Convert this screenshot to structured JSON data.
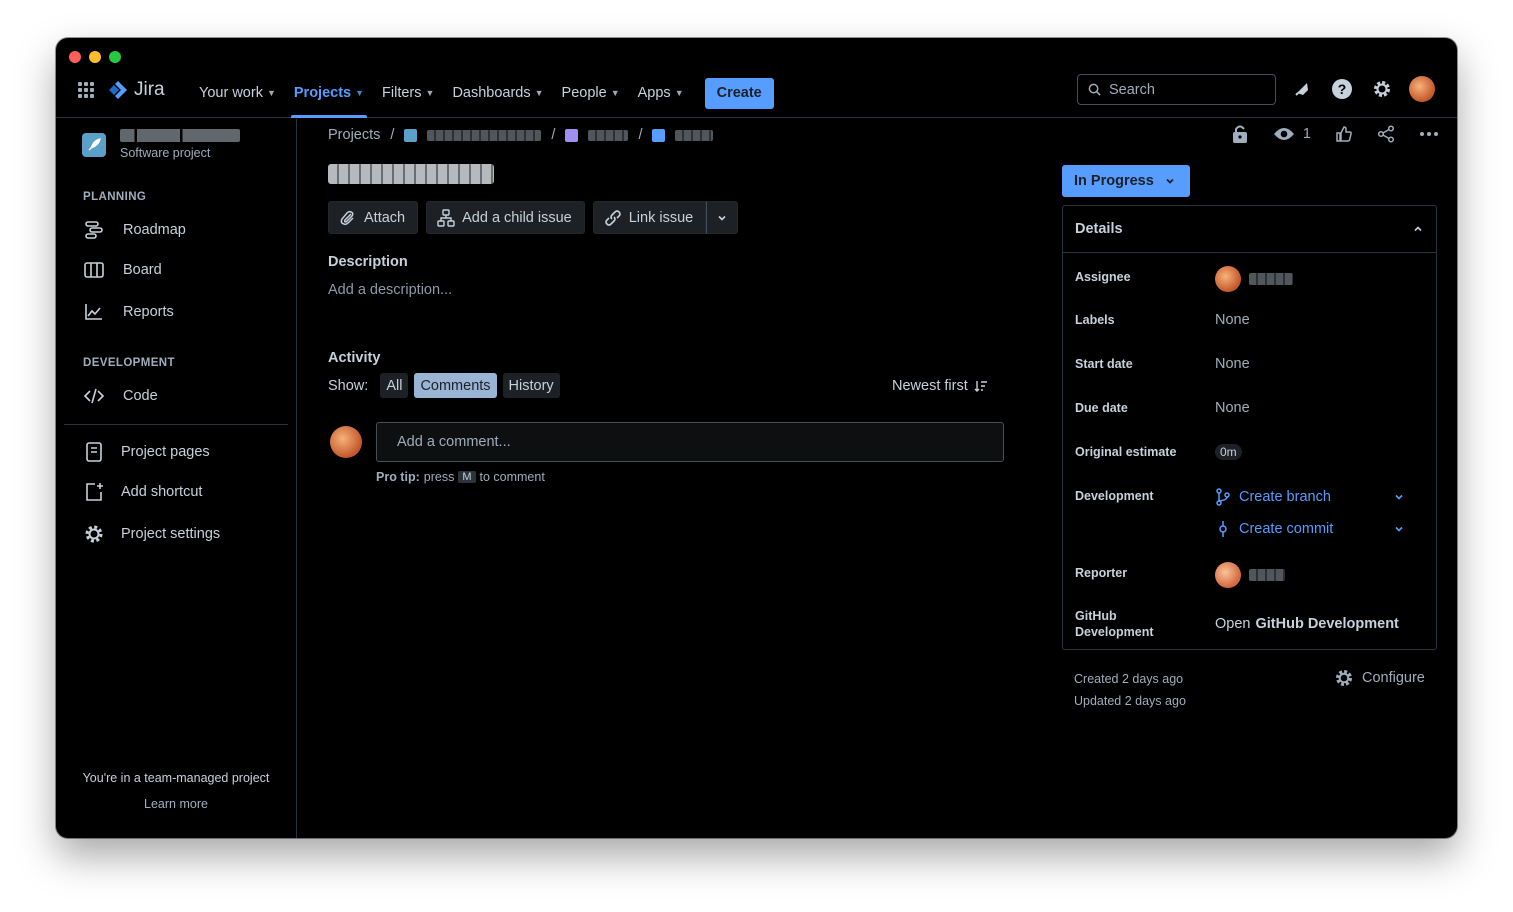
{
  "nav": {
    "logo": "Jira",
    "items": [
      {
        "label": "Your work"
      },
      {
        "label": "Projects"
      },
      {
        "label": "Filters"
      },
      {
        "label": "Dashboards"
      },
      {
        "label": "People"
      },
      {
        "label": "Apps"
      }
    ],
    "create": "Create",
    "search_placeholder": "Search"
  },
  "sidebar": {
    "project_type": "Software project",
    "planning_header": "PLANNING",
    "planning": [
      {
        "label": "Roadmap",
        "icon": "roadmap-icon"
      },
      {
        "label": "Board",
        "icon": "board-icon"
      },
      {
        "label": "Reports",
        "icon": "reports-icon"
      }
    ],
    "development_header": "DEVELOPMENT",
    "development": [
      {
        "label": "Code",
        "icon": "code-icon"
      }
    ],
    "extras": [
      {
        "label": "Project pages",
        "icon": "page-icon"
      },
      {
        "label": "Add shortcut",
        "icon": "add-shortcut-icon"
      },
      {
        "label": "Project settings",
        "icon": "gear-icon"
      }
    ],
    "team_note": "You're in a team-managed project",
    "learn_more": "Learn more"
  },
  "breadcrumb": {
    "root": "Projects",
    "sep": "/"
  },
  "toolbar": {
    "watchers": "1"
  },
  "issue": {
    "actions": {
      "attach": "Attach",
      "child": "Add a child issue",
      "link": "Link issue"
    },
    "description_header": "Description",
    "description_placeholder": "Add a description...",
    "activity_header": "Activity",
    "show_label": "Show:",
    "filters": [
      "All",
      "Comments",
      "History"
    ],
    "sort": "Newest first",
    "comment_placeholder": "Add a comment...",
    "protip_bold": "Pro tip:",
    "protip_press": "press",
    "protip_key": "M",
    "protip_rest": "to comment"
  },
  "status": {
    "label": "In Progress"
  },
  "details": {
    "header": "Details",
    "assignee_label": "Assignee",
    "labels_label": "Labels",
    "labels_value": "None",
    "start_label": "Start date",
    "start_value": "None",
    "due_label": "Due date",
    "due_value": "None",
    "estimate_label": "Original estimate",
    "estimate_value": "0m",
    "development_label": "Development",
    "create_branch": "Create branch",
    "create_commit": "Create commit",
    "reporter_label": "Reporter",
    "github_label_1": "GitHub",
    "github_label_2": "Development",
    "github_open": "Open",
    "github_value": "GitHub Development"
  },
  "meta": {
    "created": "Created 2 days ago",
    "updated": "Updated 2 days ago",
    "configure": "Configure"
  },
  "colors": {
    "accent": "#579dff",
    "background": "#000000",
    "border": "#2c333a",
    "text": "#c7d1db"
  }
}
